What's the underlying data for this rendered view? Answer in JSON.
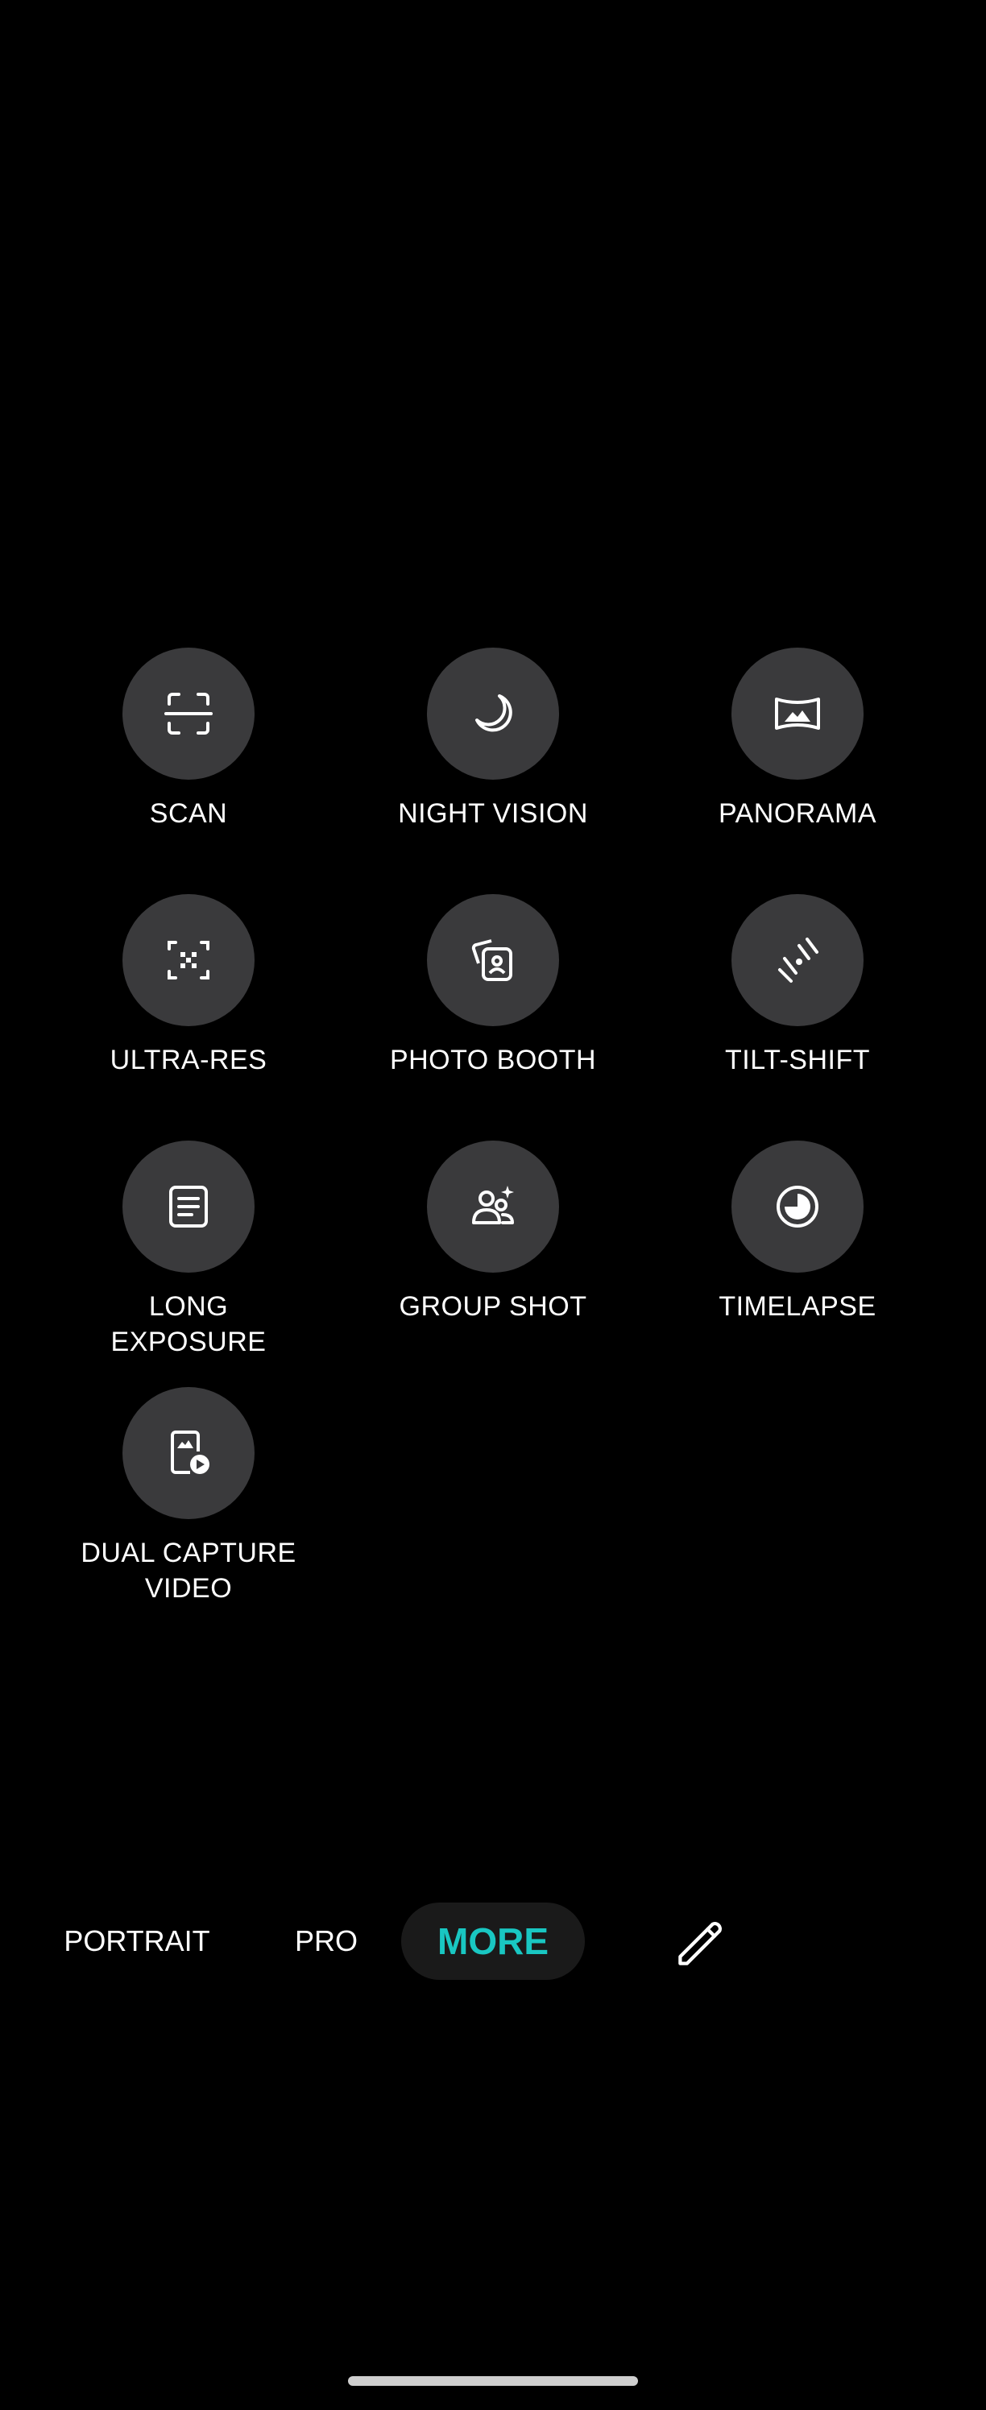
{
  "modes": [
    {
      "label": "SCAN",
      "icon": "scan-icon"
    },
    {
      "label": "NIGHT VISION",
      "icon": "moon-icon"
    },
    {
      "label": "PANORAMA",
      "icon": "panorama-icon"
    },
    {
      "label": "ULTRA-RES",
      "icon": "ultra-res-icon"
    },
    {
      "label": "PHOTO BOOTH",
      "icon": "photo-booth-icon"
    },
    {
      "label": "TILT-SHIFT",
      "icon": "tilt-shift-icon"
    },
    {
      "label": "LONG\nEXPOSURE",
      "icon": "long-exposure-icon"
    },
    {
      "label": "GROUP SHOT",
      "icon": "group-shot-icon"
    },
    {
      "label": "TIMELAPSE",
      "icon": "timelapse-icon"
    },
    {
      "label": "DUAL CAPTURE\nVIDEO",
      "icon": "dual-capture-icon"
    }
  ],
  "modebar": {
    "portrait": "PORTRAIT",
    "pro": "PRO",
    "more": "MORE",
    "edit_icon": "pencil-icon"
  },
  "colors": {
    "accent": "#19c7c2",
    "circle": "#3a3a3c",
    "background": "#000000"
  }
}
